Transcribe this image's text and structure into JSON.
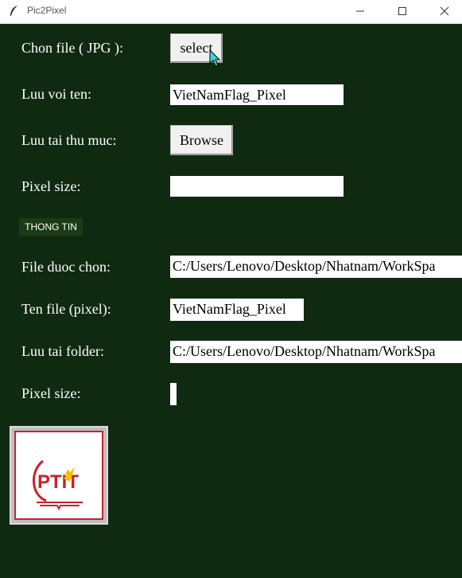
{
  "window": {
    "title": "Pic2Pixel",
    "app_icon": "feather-icon",
    "controls": [
      "minimize-icon",
      "maximize-icon",
      "close-icon"
    ]
  },
  "form": {
    "choose_file_label": "Chon file ( JPG ):",
    "select_button": "select",
    "save_name_label": "Luu voi ten:",
    "save_name_value": "VietNamFlag_Pixel",
    "save_folder_label": "Luu tai thu muc:",
    "browse_button": "Browse",
    "pixel_size_label": "Pixel size:",
    "pixel_size_value": ""
  },
  "info": {
    "section_title": "THONG TIN",
    "chosen_file_label": "File duoc chon:",
    "chosen_file_value": "C:/Users/Lenovo/Desktop/Nhatnam/WorkSpa",
    "pixel_file_label": "Ten file (pixel):",
    "pixel_file_value": "VietNamFlag_Pixel",
    "folder_label": "Luu tai folder:",
    "folder_value": "C:/Users/Lenovo/Desktop/Nhatnam/WorkSpa",
    "pixel_size_label": "Pixel size:",
    "pixel_size_value": ""
  },
  "logo": {
    "text": "PTIT"
  },
  "colors": {
    "background": "#0f2a10",
    "section_bg": "#1a3b16",
    "logo_red": "#c8232c",
    "cursor": "#3fd1d6"
  }
}
